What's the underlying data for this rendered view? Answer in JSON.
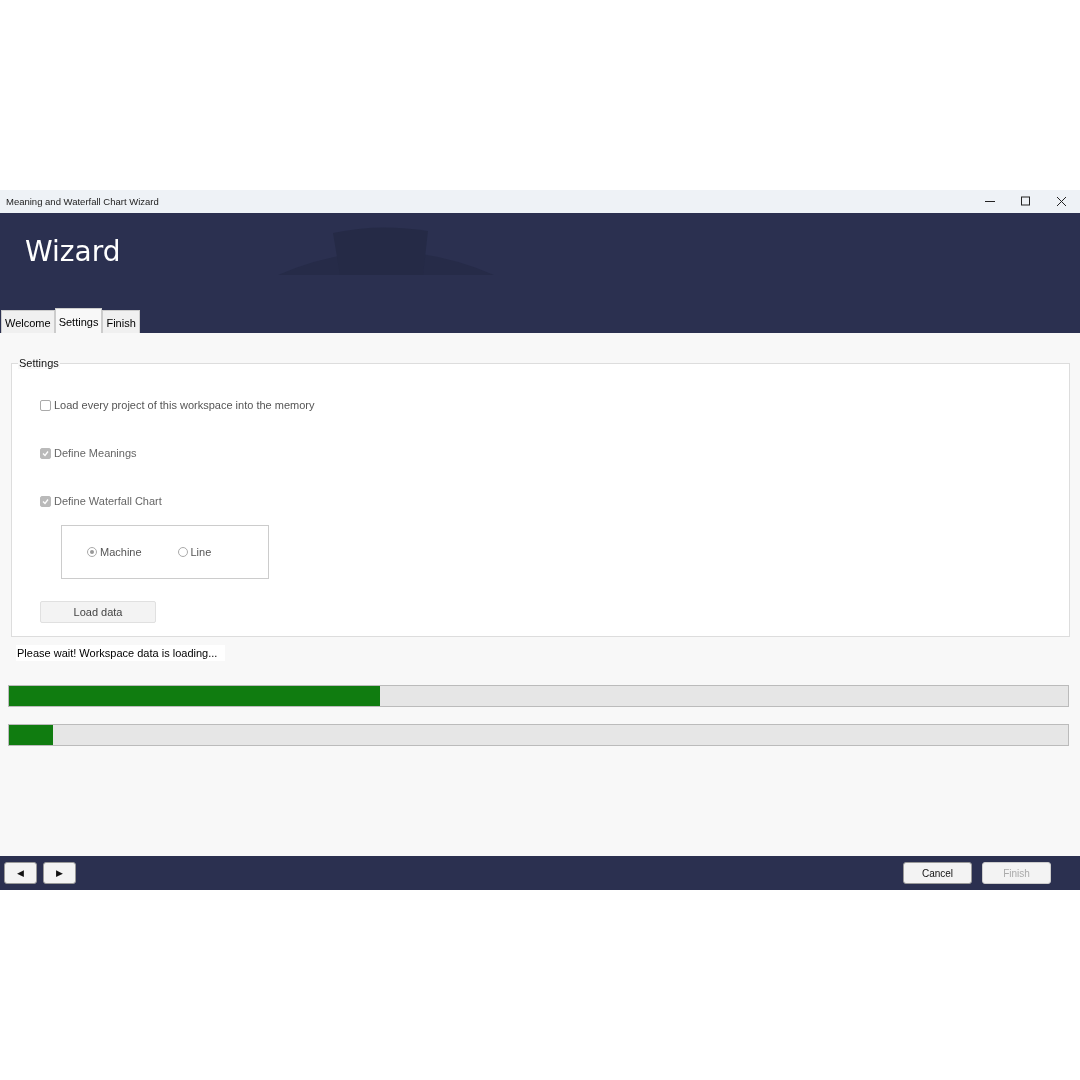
{
  "window": {
    "title": "Meaning and Waterfall Chart Wizard"
  },
  "header": {
    "title": "Wizard"
  },
  "tabs": [
    {
      "label": "Welcome",
      "selected": false
    },
    {
      "label": "Settings",
      "selected": true
    },
    {
      "label": "Finish",
      "selected": false
    }
  ],
  "settings_group": {
    "title": "Settings",
    "checkboxes": [
      {
        "label": "Load every project of this workspace into the memory",
        "checked": false,
        "disabled": false
      },
      {
        "label": "Define Meanings",
        "checked": true,
        "disabled": true
      },
      {
        "label": "Define Waterfall Chart",
        "checked": true,
        "disabled": true
      }
    ],
    "radios": [
      {
        "label": "Machine",
        "selected": true
      },
      {
        "label": "Line",
        "selected": false
      }
    ],
    "load_button": "Load data"
  },
  "status": "Please wait! Workspace data is loading...",
  "progress_bars": [
    {
      "level": 0.35
    },
    {
      "level": 0.042
    }
  ],
  "footer": {
    "nav_buttons": [
      "◀",
      "▶"
    ],
    "buttons": [
      {
        "label": "Cancel",
        "disabled": false
      },
      {
        "label": "Finish",
        "disabled": true
      }
    ]
  }
}
